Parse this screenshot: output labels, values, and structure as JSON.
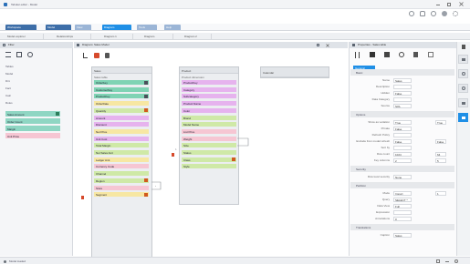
{
  "app": {
    "title": "Tabular editor - Model",
    "window_controls": [
      "minimize-icon",
      "maximize-icon",
      "close-icon"
    ]
  },
  "top_icons": [
    "person-icon",
    "bell-icon",
    "help-icon",
    "user-icon",
    "gear-icon"
  ],
  "ribbon_tabs": [
    {
      "label": "Workspace",
      "active": false
    },
    {
      "label": "Model",
      "active": false
    },
    {
      "label": "View",
      "active": false
    },
    {
      "label": "Diagram",
      "active": true
    },
    {
      "label": "Tools",
      "active": false
    },
    {
      "label": "Help",
      "active": false
    }
  ],
  "doc_tabs": [
    {
      "label": "Model explorer"
    },
    {
      "label": "Relationships"
    },
    {
      "label": "Diagram 1"
    },
    {
      "label": "Diagram"
    },
    {
      "label": "Diagram 2"
    }
  ],
  "left_panel": {
    "title": "Filter",
    "toolbar_icons": [
      "list-icon",
      "expand-icon",
      "collapse-icon"
    ],
    "tree": [
      "Tables",
      "Model",
      "Dim",
      "Fact",
      "Calc",
      "Roles"
    ],
    "chips": [
      {
        "label": "Sales Amount",
        "color": "#8fd6c3",
        "flag": "#2e7d5b"
      },
      {
        "label": "Order Count",
        "color": "#8fd6c3",
        "flag": ""
      },
      {
        "label": "Margin",
        "color": "#8fd6c3",
        "flag": ""
      },
      {
        "label": "Unit Price",
        "color": "#f6c6d3",
        "flag": ""
      }
    ]
  },
  "canvas": {
    "title": "Diagram: Sales Model",
    "toolbar_icons": [
      "cursor-icon",
      "add-table-icon",
      "pin-icon",
      "zoom-icon"
    ],
    "nodes": [
      {
        "title": "Sales",
        "subtitle": "Sales table",
        "fields": [
          {
            "label": "OrderKey",
            "color": "#7fd3b4",
            "flag": "#4a4f5a"
          },
          {
            "label": "CustomerKey",
            "color": "#7fd3b4",
            "flag": ""
          },
          {
            "label": "ProductKey",
            "color": "#7fd3b4",
            "flag": "#4a4f5a"
          },
          {
            "label": "OrderDate",
            "color": "#f7e7a3",
            "flag": ""
          },
          {
            "label": "Quantity",
            "color": "#cfe9a7",
            "flag": "#d05a1e"
          },
          {
            "label": "Amount",
            "color": "#e6b3ee",
            "flag": ""
          },
          {
            "label": "Discount",
            "color": "#e6b3ee",
            "flag": ""
          },
          {
            "label": "Net Price",
            "color": "#f7e7a3",
            "flag": ""
          },
          {
            "label": "Unit Cost",
            "color": "#e6b3ee",
            "flag": ""
          },
          {
            "label": "Total Margin",
            "color": "#cfe9a7",
            "flag": ""
          },
          {
            "label": "Net Sales Amt",
            "color": "#cfe9a7",
            "flag": ""
          },
          {
            "label": "Ledger Amt",
            "color": "#f7e7a3",
            "flag": ""
          },
          {
            "label": "Currency Code",
            "color": "#f6c6d3",
            "flag": ""
          },
          {
            "label": "Channel",
            "color": "#cfe9a7",
            "flag": ""
          },
          {
            "label": "Region",
            "color": "#cfe9a7",
            "flag": "#d05a1e"
          },
          {
            "label": "Store",
            "color": "#f6c6d3",
            "flag": ""
          },
          {
            "label": "Segment",
            "color": "#f7e7a3",
            "flag": "#d05a1e"
          }
        ]
      },
      {
        "title": "Product",
        "subtitle": "Product dimension",
        "fields": [
          {
            "label": "ProductKey",
            "color": "#e6b3ee",
            "flag": ""
          },
          {
            "label": "Category",
            "color": "#e6b3ee",
            "flag": ""
          },
          {
            "label": "Subcategory",
            "color": "#e6b3ee",
            "flag": ""
          },
          {
            "label": "Product Name",
            "color": "#e6b3ee",
            "flag": ""
          },
          {
            "label": "Color",
            "color": "#e6b3ee",
            "flag": ""
          },
          {
            "label": "Brand",
            "color": "#cfe9a7",
            "flag": ""
          },
          {
            "label": "Model Name",
            "color": "#cfe9a7",
            "flag": ""
          },
          {
            "label": "List Price",
            "color": "#f6c6d3",
            "flag": ""
          },
          {
            "label": "Weight",
            "color": "#f6c6d3",
            "flag": ""
          },
          {
            "label": "Size",
            "color": "#cfe9a7",
            "flag": ""
          },
          {
            "label": "Status",
            "color": "#cfe9a7",
            "flag": ""
          },
          {
            "label": "Class",
            "color": "#cfe9a7",
            "flag": "#d05a1e"
          },
          {
            "label": "Style",
            "color": "#cfe9a7",
            "flag": ""
          }
        ]
      },
      {
        "title": "Calendar",
        "subtitle": "",
        "fields": []
      }
    ],
    "small_labels": [
      "1",
      "*"
    ]
  },
  "properties": {
    "title": "Properties - Sales table",
    "toolbar_icons": [
      "sort-icon",
      "category-icon",
      "filter-icon",
      "search-icon",
      "pin-icon",
      "more-icon"
    ],
    "tab_active": "General",
    "sections": [
      {
        "name": "Basic",
        "rows": [
          {
            "label": "Name",
            "value": "Sales",
            "value2": ""
          },
          {
            "label": "Description",
            "value": "",
            "value2": ""
          },
          {
            "label": "Hidden",
            "value": "False",
            "value2": ""
          },
          {
            "label": "Data Category",
            "value": "",
            "value2": ""
          },
          {
            "label": "Source",
            "value": "SQL",
            "value2": ""
          }
        ]
      },
      {
        "name": "Options",
        "rows": [
          {
            "label": "Show as variation",
            "value": "True",
            "value2": "True"
          },
          {
            "label": "Private",
            "value": "False",
            "value2": ""
          },
          {
            "label": "Refresh Policy",
            "value": "",
            "value2": ""
          },
          {
            "label": "Exclude from model refresh",
            "value": "False",
            "value2": "False"
          },
          {
            "label": "Sort by",
            "value": "",
            "value2": ""
          },
          {
            "label": "Row count",
            "value": "1024",
            "value2": "64"
          },
          {
            "label": "Key columns",
            "value": "2",
            "value2": "5"
          }
        ]
      },
      {
        "name": "Security",
        "rows": [
          {
            "label": "Row level security",
            "value": "None",
            "value2": ""
          }
        ]
      },
      {
        "name": "Partition",
        "rows": [
          {
            "label": "Mode",
            "value": "Import",
            "value2": "1"
          },
          {
            "label": "Query",
            "value": "SELECT *",
            "value2": ""
          },
          {
            "label": "Data View",
            "value": "Full",
            "value2": ""
          },
          {
            "label": "Expression",
            "value": "",
            "value2": ""
          },
          {
            "label": "Annotations",
            "value": "0",
            "value2": ""
          }
        ]
      },
      {
        "name": "Translations",
        "rows": [
          {
            "label": "Caption",
            "value": "Sales",
            "value2": ""
          }
        ]
      }
    ]
  },
  "right_rail": [
    "pin-icon",
    "properties-icon",
    "search-icon",
    "help-icon",
    "tag-icon",
    "diagram-icon"
  ],
  "status_bar": {
    "left_text": "Model loaded",
    "right_icons": [
      "grid-icon",
      "zoom-out-icon",
      "zoom-in-icon"
    ]
  },
  "colors": {
    "accent": "#1f8fe6",
    "accent_dark": "#2a6fb8",
    "green_field": "#cfe9a7",
    "teal_field": "#7fd3b4",
    "purple_field": "#e6b3ee",
    "yellow_field": "#f7e7a3",
    "pink_field": "#f6c6d3",
    "flag_red": "#d05a1e"
  }
}
